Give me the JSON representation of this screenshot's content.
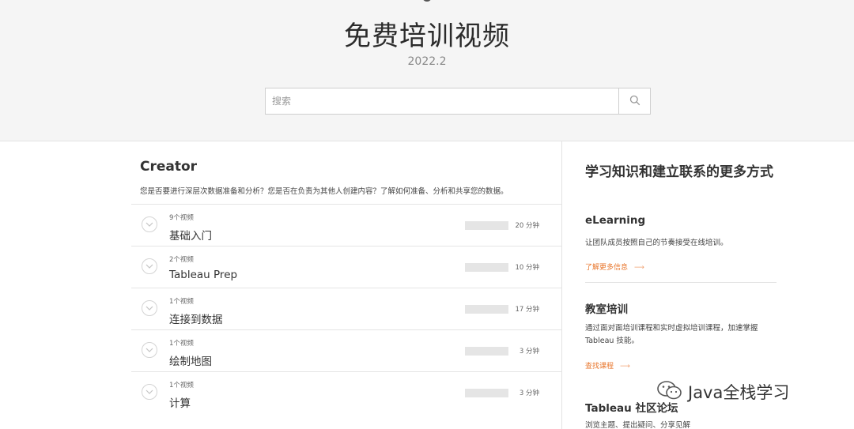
{
  "header": {
    "title": "免费培训视频",
    "subtitle": "2022.2",
    "search_placeholder": "搜索"
  },
  "creator": {
    "title": "Creator",
    "description": "您是否要进行深层次数据准备和分析？您是否在负责为其他人创建内容？了解如何准备、分析和共享您的数据。",
    "modules": [
      {
        "count": "9个视频",
        "name": "基础入门",
        "duration": "20 分钟"
      },
      {
        "count": "2个视频",
        "name": "Tableau Prep",
        "duration": "10 分钟"
      },
      {
        "count": "1个视频",
        "name": "连接到数据",
        "duration": "17 分钟"
      },
      {
        "count": "1个视频",
        "name": "绘制地图",
        "duration": "3 分钟"
      },
      {
        "count": "1个视频",
        "name": "计算",
        "duration": "3 分钟"
      }
    ]
  },
  "sidebar": {
    "title": "学习知识和建立联系的更多方式",
    "elearning": {
      "heading": "eLearning",
      "text": "让团队成员按照自己的节奏接受在线培训。",
      "link": "了解更多信息"
    },
    "classroom": {
      "heading": "教室培训",
      "text": "通过面对面培训课程和实时虚拟培训课程，加速掌握 Tableau 技能。",
      "link": "查找课程"
    },
    "community": {
      "heading": "Tableau 社区论坛",
      "text": "浏览主题、提出疑问、分享见解"
    }
  },
  "watermark": {
    "text": "Java全栈学习"
  },
  "colors": {
    "accent": "#e8762c",
    "hero_bg": "#f5f5f5"
  }
}
